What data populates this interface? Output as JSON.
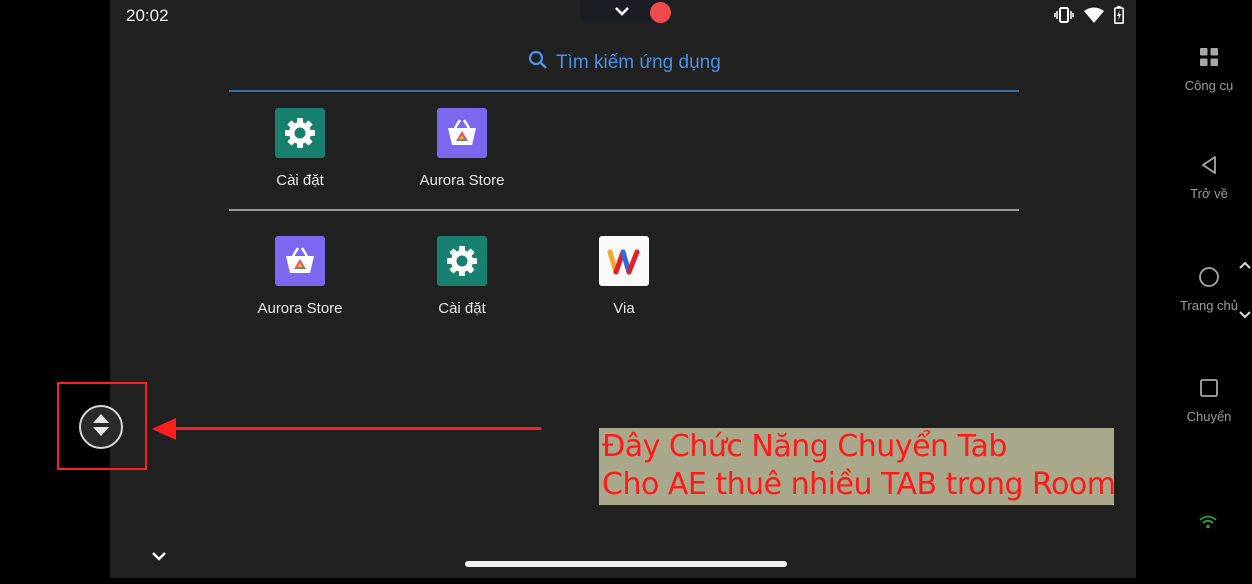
{
  "status_bar": {
    "time": "20:02"
  },
  "search": {
    "label": "Tìm kiếm ứng dụng"
  },
  "apps_top": [
    {
      "label": "Cài đặt",
      "icon": "settings-icon"
    },
    {
      "label": "Aurora Store",
      "icon": "aurora-store-icon"
    }
  ],
  "apps_all": [
    {
      "label": "Aurora Store",
      "icon": "aurora-store-icon"
    },
    {
      "label": "Cài đặt",
      "icon": "settings-icon"
    },
    {
      "label": "Via",
      "icon": "via-browser-icon"
    }
  ],
  "annotation": {
    "line1": "Đây Chức Năng Chuyển Tab",
    "line2": "Cho AE thuê nhiều TAB trong Room"
  },
  "sidebar": {
    "tools_label": "Công cụ",
    "back_label": "Trở về",
    "home_label": "Trang chủ",
    "switch_label": "Chuyển"
  },
  "colors": {
    "accent_blue": "#4c8fe8",
    "annotation_red": "#ff1f1f",
    "settings_green": "#17806e",
    "aurora_purple": "#7b68ee"
  }
}
